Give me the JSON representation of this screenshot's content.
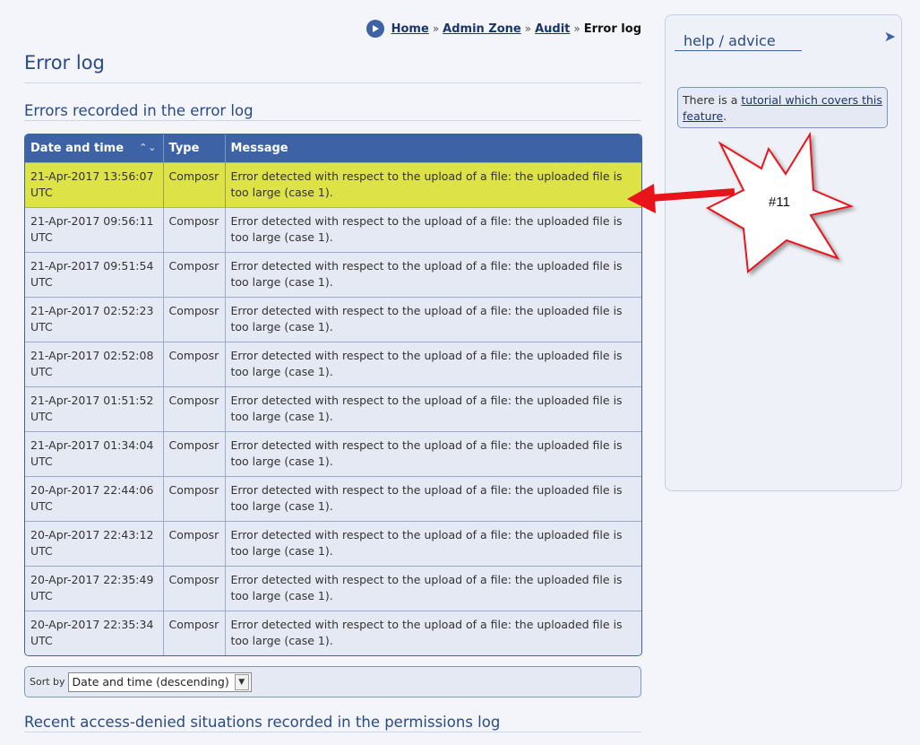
{
  "breadcrumb": {
    "items": [
      "Home",
      "Admin Zone",
      "Audit"
    ],
    "separator": "»",
    "current": "Error log"
  },
  "page_title": "Error log",
  "section1_title": "Errors recorded in the error log",
  "table": {
    "headers": [
      "Date and time",
      "Type",
      "Message"
    ],
    "sort_indicator": "^v",
    "rows": [
      {
        "date": "21-Apr-2017 13:56:07 UTC",
        "type": "Composr",
        "message": "Error detected with respect to the upload of a file: the uploaded file is too large (case 1).",
        "highlighted": true
      },
      {
        "date": "21-Apr-2017 09:56:11 UTC",
        "type": "Composr",
        "message": "Error detected with respect to the upload of a file: the uploaded file is too large (case 1)."
      },
      {
        "date": "21-Apr-2017 09:51:54 UTC",
        "type": "Composr",
        "message": "Error detected with respect to the upload of a file: the uploaded file is too large (case 1)."
      },
      {
        "date": "21-Apr-2017 02:52:23 UTC",
        "type": "Composr",
        "message": "Error detected with respect to the upload of a file: the uploaded file is too large (case 1)."
      },
      {
        "date": "21-Apr-2017 02:52:08 UTC",
        "type": "Composr",
        "message": "Error detected with respect to the upload of a file: the uploaded file is too large (case 1)."
      },
      {
        "date": "21-Apr-2017 01:51:52 UTC",
        "type": "Composr",
        "message": "Error detected with respect to the upload of a file: the uploaded file is too large (case 1)."
      },
      {
        "date": "21-Apr-2017 01:34:04 UTC",
        "type": "Composr",
        "message": "Error detected with respect to the upload of a file: the uploaded file is too large (case 1)."
      },
      {
        "date": "20-Apr-2017 22:44:06 UTC",
        "type": "Composr",
        "message": "Error detected with respect to the upload of a file: the uploaded file is too large (case 1)."
      },
      {
        "date": "20-Apr-2017 22:43:12 UTC",
        "type": "Composr",
        "message": "Error detected with respect to the upload of a file: the uploaded file is too large (case 1)."
      },
      {
        "date": "20-Apr-2017 22:35:49 UTC",
        "type": "Composr",
        "message": "Error detected with respect to the upload of a file: the uploaded file is too large (case 1)."
      },
      {
        "date": "20-Apr-2017 22:35:34 UTC",
        "type": "Composr",
        "message": "Error detected with respect to the upload of a file: the uploaded file is too large (case 1)."
      }
    ]
  },
  "sort": {
    "label": "Sort by",
    "selected": "Date and time (descending)"
  },
  "section2_title": "Recent access-denied situations recorded in the permissions log",
  "sidebar": {
    "title": "help / advice",
    "tip_prefix": "There is a ",
    "tip_link": "tutorial which covers this feature",
    "tip_suffix": "."
  },
  "annotation": {
    "label": "#11"
  },
  "colors": {
    "header_blue": "#3d63a6",
    "highlight_row": "#dde246",
    "annotation_arrow": "#e8141a"
  }
}
